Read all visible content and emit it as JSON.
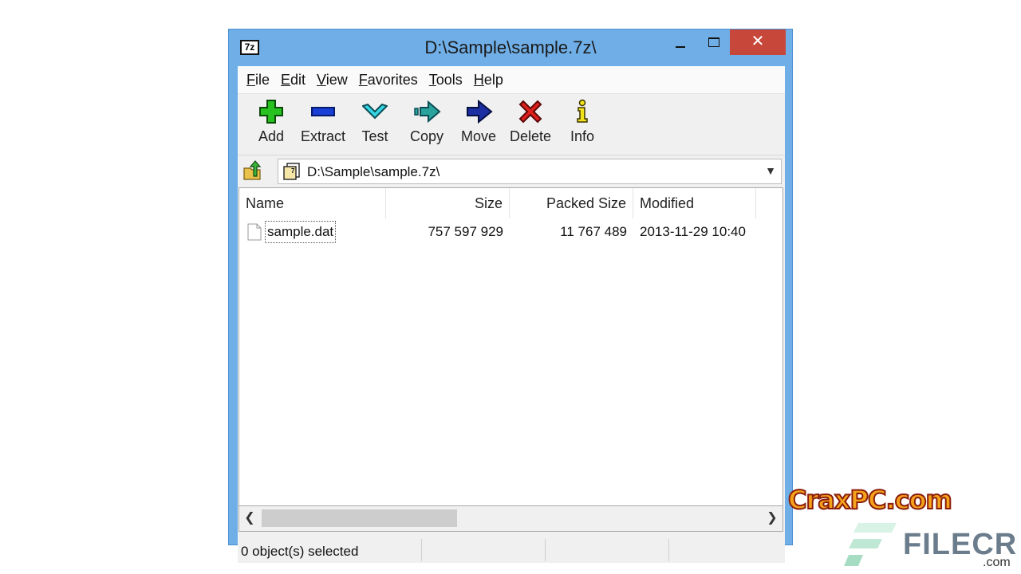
{
  "window": {
    "title": "D:\\Sample\\sample.7z\\",
    "app_icon_text": "7z",
    "close_glyph": "✕"
  },
  "menu": [
    "File",
    "Edit",
    "View",
    "Favorites",
    "Tools",
    "Help"
  ],
  "toolbar": [
    {
      "label": "Add",
      "icon": "add-icon"
    },
    {
      "label": "Extract",
      "icon": "extract-icon"
    },
    {
      "label": "Test",
      "icon": "test-icon"
    },
    {
      "label": "Copy",
      "icon": "copy-icon"
    },
    {
      "label": "Move",
      "icon": "move-icon"
    },
    {
      "label": "Delete",
      "icon": "delete-icon"
    },
    {
      "label": "Info",
      "icon": "info-icon"
    }
  ],
  "address": {
    "path": "D:\\Sample\\sample.7z\\"
  },
  "list": {
    "columns": [
      "Name",
      "Size",
      "Packed Size",
      "Modified"
    ],
    "rows": [
      {
        "name": "sample.dat",
        "size": "757 597 929",
        "packed": "11 767 489",
        "modified": "2013-11-29 10:40"
      }
    ]
  },
  "status": {
    "text": "0 object(s) selected"
  },
  "watermarks": {
    "crax": "CraxPC.com",
    "filecr": "FILECR",
    "filecr_com": ".com"
  },
  "colors": {
    "frame": "#6faee6",
    "close": "#c7473a"
  }
}
